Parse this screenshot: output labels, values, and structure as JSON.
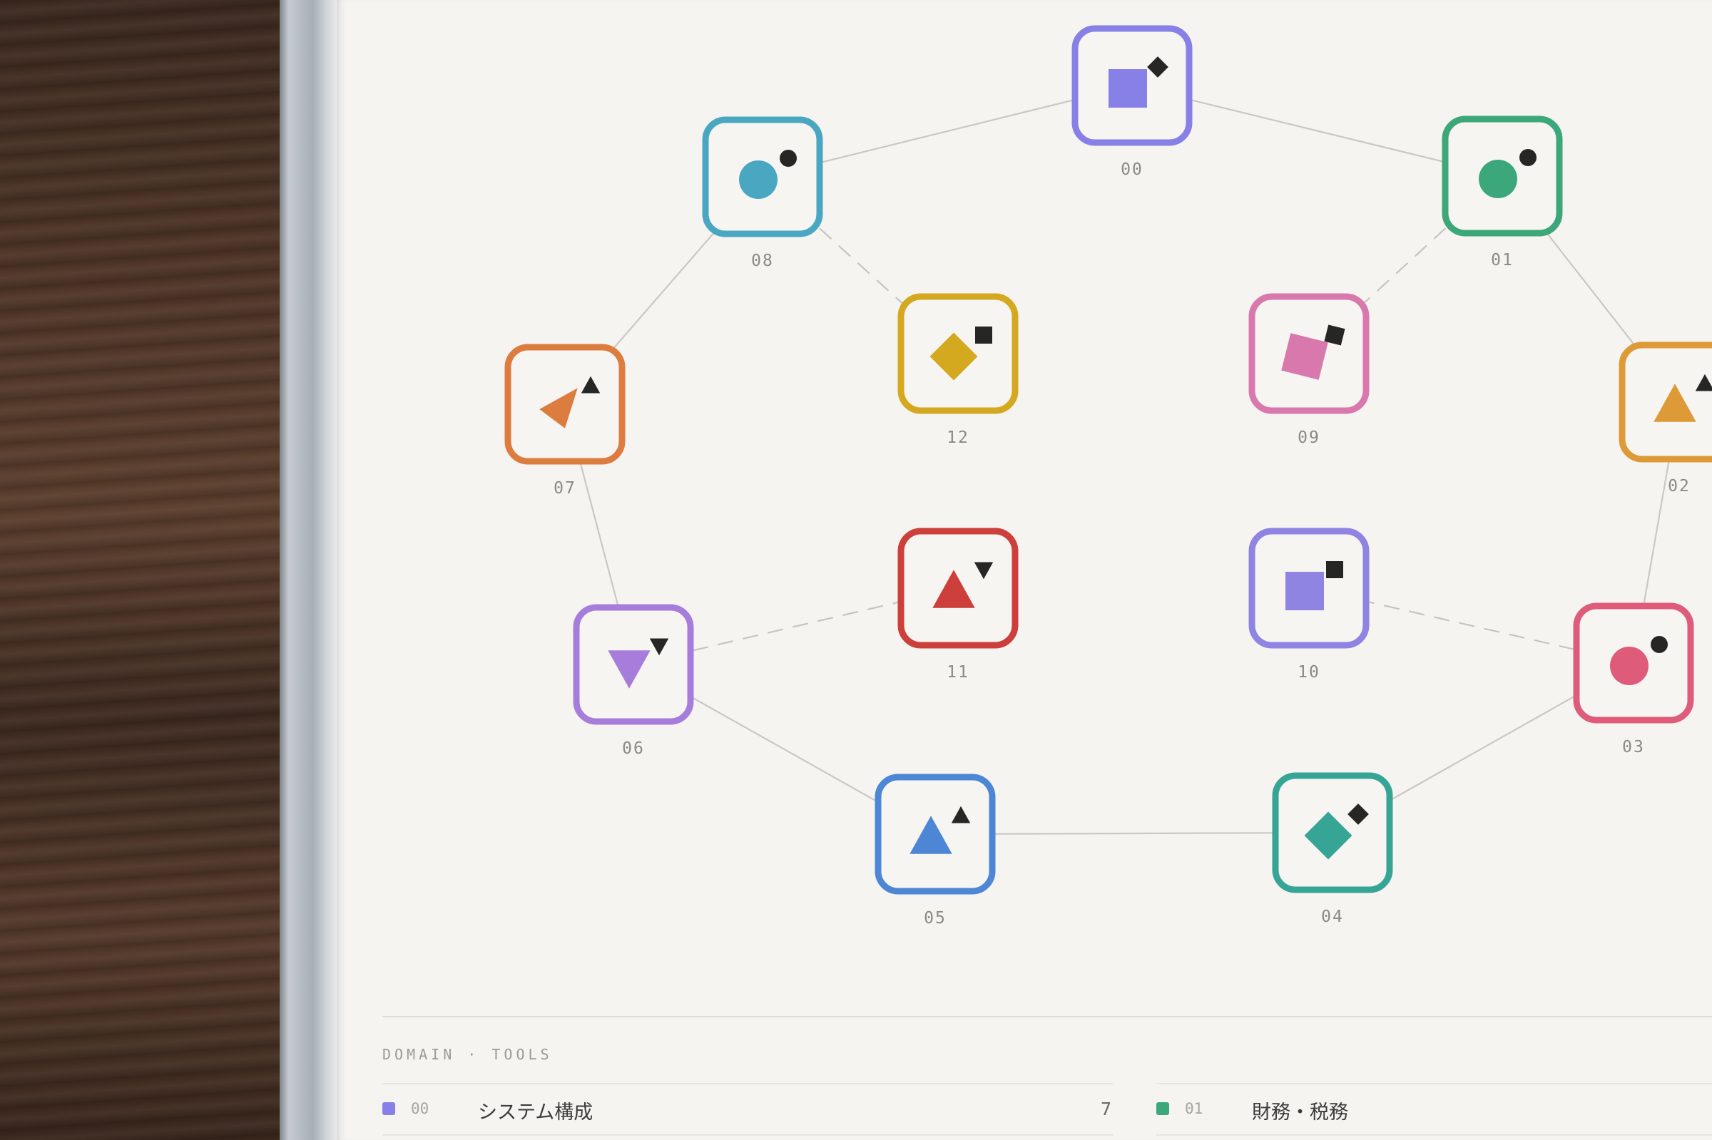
{
  "nodes": [
    {
      "id": "00",
      "color": "#8780e6",
      "shape": "square",
      "accent": "diamond"
    },
    {
      "id": "01",
      "color": "#3ca77b",
      "shape": "circle",
      "accent": "circle"
    },
    {
      "id": "02",
      "color": "#dd9a36",
      "shape": "triangle-up",
      "accent": "triangle-up"
    },
    {
      "id": "03",
      "color": "#df5b7a",
      "shape": "circle",
      "accent": "circle"
    },
    {
      "id": "04",
      "color": "#37a596",
      "shape": "diamond",
      "accent": "diamond"
    },
    {
      "id": "05",
      "color": "#4e86d6",
      "shape": "triangle-up",
      "accent": "triangle-up"
    },
    {
      "id": "06",
      "color": "#a77ddc",
      "shape": "triangle-down",
      "accent": "triangle-down"
    },
    {
      "id": "07",
      "color": "#dd7c3f",
      "shape": "triangle-left",
      "accent": "triangle-up"
    },
    {
      "id": "08",
      "color": "#4aa7c2",
      "shape": "circle",
      "accent": "circle"
    },
    {
      "id": "09",
      "color": "#d978ad",
      "shape": "square-rotated",
      "accent": "square-rotated"
    },
    {
      "id": "10",
      "color": "#8f84e2",
      "shape": "square",
      "accent": "square"
    },
    {
      "id": "11",
      "color": "#cc3f3b",
      "shape": "triangle-up",
      "accent": "triangle-down"
    },
    {
      "id": "12",
      "color": "#d4a81f",
      "shape": "diamond",
      "accent": "square"
    }
  ],
  "legend": {
    "section_label": "DOMAIN · TOOLS",
    "items": [
      {
        "num": "00",
        "name": "システム構成",
        "count": "7",
        "color": "#8780e6"
      },
      {
        "num": "01",
        "name": "財務・税務",
        "count": "",
        "color": "#3ca77b"
      }
    ]
  }
}
